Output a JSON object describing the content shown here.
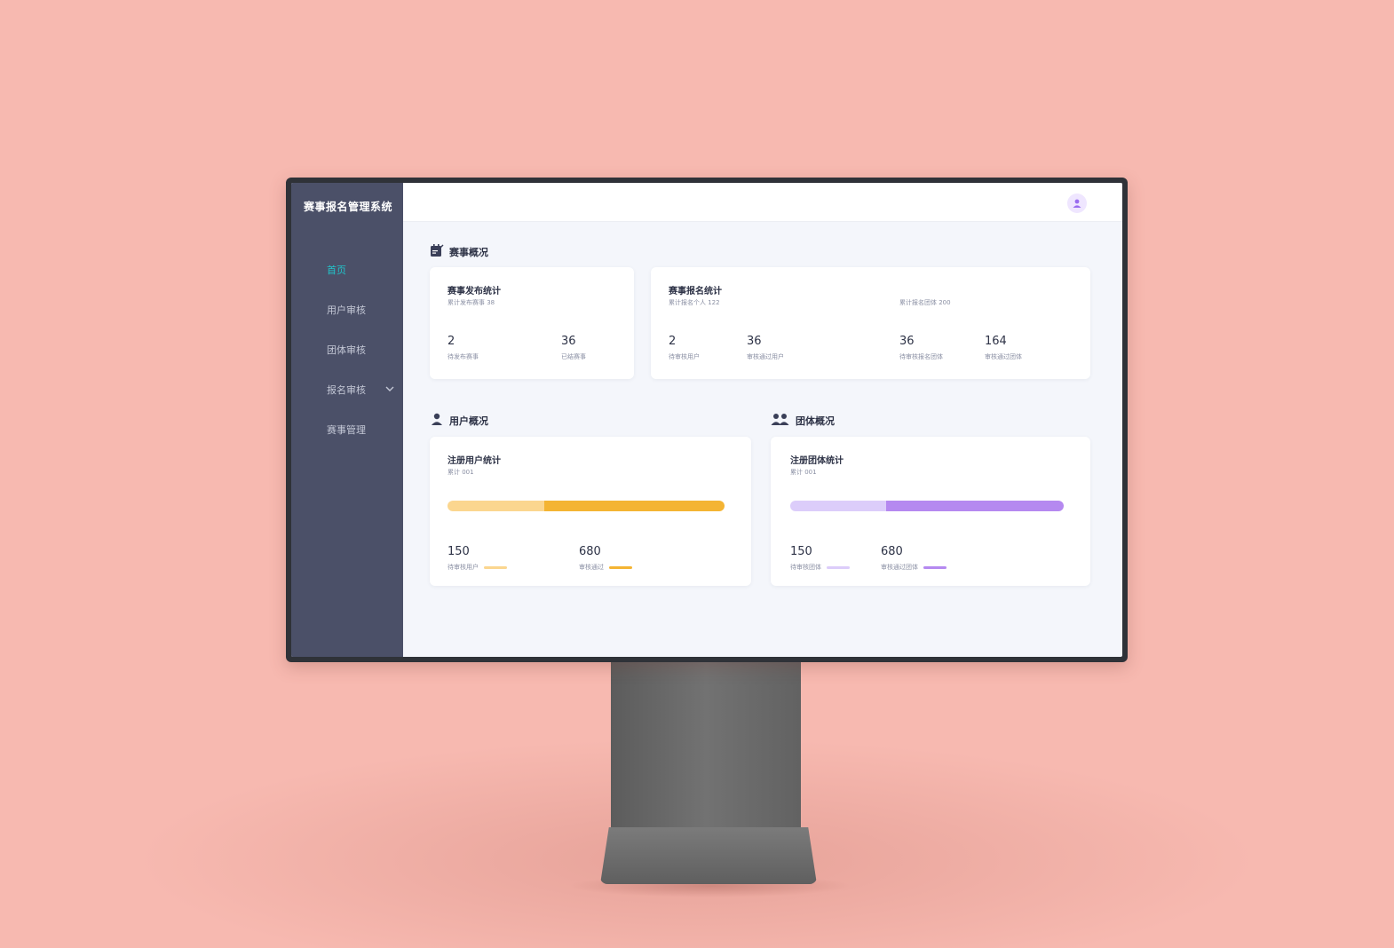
{
  "colors": {
    "background": "#f7b9b0",
    "sidebar": "#4b5068",
    "accent_active": "#22c3c9",
    "user_bar_light": "#fbd68f",
    "user_bar_dark": "#f4b433",
    "group_bar_light": "#dccdfa",
    "group_bar_dark": "#b589f0"
  },
  "app": {
    "title": "赛事报名管理系统"
  },
  "sidebar": {
    "items": [
      {
        "label": "首页",
        "active": true
      },
      {
        "label": "用户审核",
        "active": false
      },
      {
        "label": "团体审核",
        "active": false
      },
      {
        "label": "报名审核",
        "active": false,
        "has_submenu": true
      },
      {
        "label": "赛事管理",
        "active": false
      }
    ]
  },
  "header": {
    "avatar_icon": "user-avatar-icon"
  },
  "event_overview": {
    "title": "赛事概况",
    "icon": "event-edit-icon",
    "publish_card": {
      "title": "赛事发布统计",
      "sub": "累计发布赛事 38",
      "stats": [
        {
          "value": "2",
          "label": "待发布赛事"
        },
        {
          "value": "36",
          "label": "已结赛事"
        }
      ]
    },
    "signup_card": {
      "title": "赛事报名统计",
      "sub_left": "累计报名个人 122",
      "sub_right": "累计报名团体 200",
      "stats": [
        {
          "value": "2",
          "label": "待审核用户"
        },
        {
          "value": "36",
          "label": "审核通过用户"
        },
        {
          "value": "36",
          "label": "待审核报名团体"
        },
        {
          "value": "164",
          "label": "审核通过团体"
        }
      ]
    }
  },
  "user_overview": {
    "title": "用户概况",
    "icon": "user-icon",
    "card": {
      "title": "注册用户统计",
      "sub": "累计 001",
      "bar_fraction": 0.35,
      "stats": [
        {
          "value": "150",
          "label": "待审核用户"
        },
        {
          "value": "680",
          "label": "审核通过"
        }
      ]
    }
  },
  "group_overview": {
    "title": "团体概况",
    "icon": "group-icon",
    "card": {
      "title": "注册团体统计",
      "sub": "累计 001",
      "bar_fraction": 0.35,
      "stats": [
        {
          "value": "150",
          "label": "待审核团体"
        },
        {
          "value": "680",
          "label": "审核通过团体"
        }
      ]
    }
  }
}
